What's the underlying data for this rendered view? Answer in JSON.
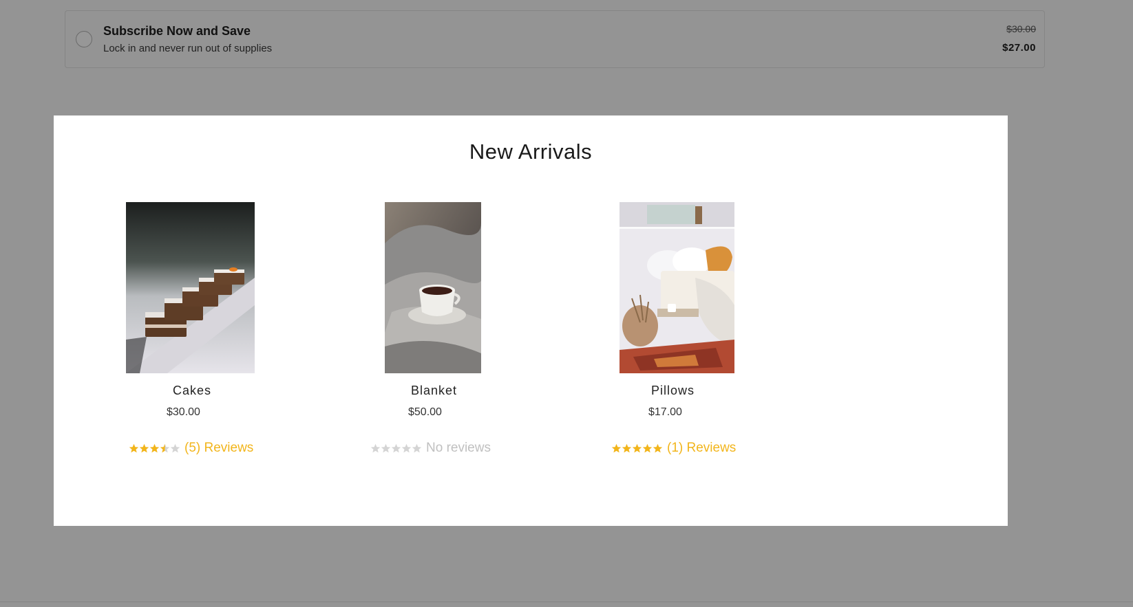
{
  "subscription": {
    "title": "Subscribe Now and Save",
    "description": "Lock in and never run out of supplies",
    "original_price": "$30.00",
    "sale_price": "$27.00"
  },
  "modal": {
    "title": "New Arrivals",
    "products": [
      {
        "name": "Cakes",
        "price": "$30.00",
        "rating_stars": 3.5,
        "reviews_text": "(5) Reviews",
        "has_reviews": true
      },
      {
        "name": "Blanket",
        "price": "$50.00",
        "rating_stars": 0,
        "reviews_text": "No reviews",
        "has_reviews": false
      },
      {
        "name": "Pillows",
        "price": "$17.00",
        "rating_stars": 5,
        "reviews_text": "(1) Reviews",
        "has_reviews": true
      }
    ]
  },
  "colors": {
    "overlay": "#949494",
    "star_filled": "#f2b51b",
    "star_empty": "#d4d4d4",
    "reviews_link": "#f2b51b"
  }
}
